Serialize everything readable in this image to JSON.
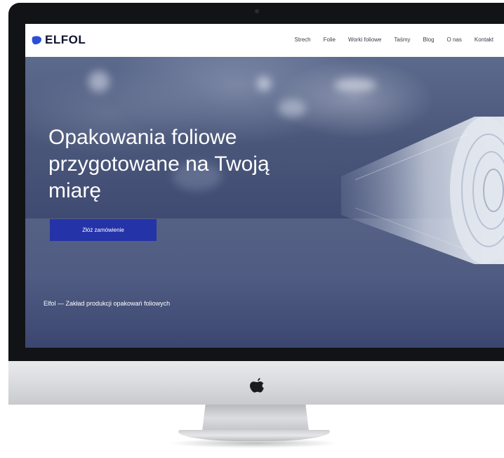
{
  "brand": {
    "name": "ELFOL",
    "logo_icon": "blue-leaf-icon",
    "logo_color": "#2a4fd6"
  },
  "nav": {
    "items": [
      {
        "label": "Strech"
      },
      {
        "label": "Folie"
      },
      {
        "label": "Worki foliowe"
      },
      {
        "label": "Taśmy"
      },
      {
        "label": "Blog"
      },
      {
        "label": "O nas"
      },
      {
        "label": "Kontakt"
      }
    ]
  },
  "hero": {
    "headline": "Opakowania foliowe\nprzygotowane na Twoją\nmiarę",
    "cta_label": "Złóż zamówienie",
    "tagline": "Elfol — Zakład produkcji opakowań foliowych"
  },
  "colors": {
    "cta_background": "#2433a8",
    "hero_overlay": "#3f4b72",
    "nav_background": "#ffffff"
  },
  "device": {
    "icon": "apple-logo-icon"
  }
}
